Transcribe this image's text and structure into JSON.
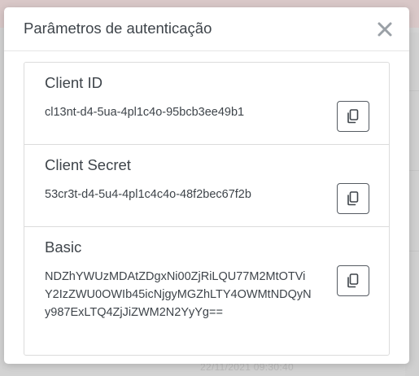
{
  "modal": {
    "title": "Parâmetros de autenticação",
    "close_icon": "close-icon"
  },
  "credentials": [
    {
      "label": "Client ID",
      "value": "cl13nt-d4-5ua-4pl1c4o-95bcb3ee49b1",
      "action_icon": "copy-icon"
    },
    {
      "label": "Client Secret",
      "value": "53cr3t-d4-5u4-4pl1c4c4o-48f2bec67f2b",
      "action_icon": "copy-icon"
    },
    {
      "label": "Basic",
      "value": "NDZhYWUzMDAtZDgxNi00ZjRiLQU77M2MtOTViY2IzZWU0OWIb45icNjgyMGZhLTY4OWMtNDQyNy987ExLTQ4ZjJiZWM2N2YyYg==",
      "action_icon": "copy-icon"
    }
  ],
  "background": {
    "timestamp": "22/11/2021 09:30:40"
  },
  "colors": {
    "text": "#3e444a",
    "border": "#dcdcdc",
    "button_border": "#555b62",
    "close": "#9aa0a6"
  }
}
